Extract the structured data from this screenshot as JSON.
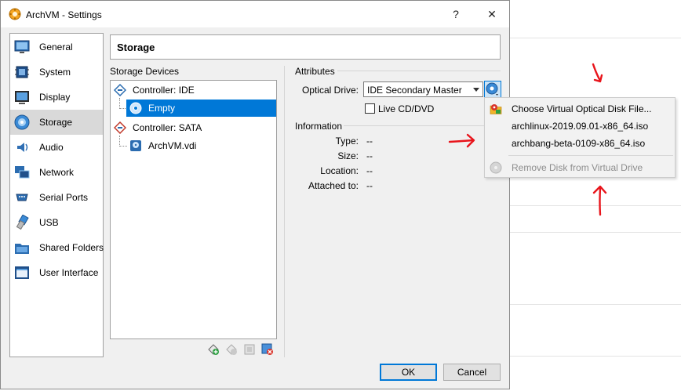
{
  "window": {
    "title": "ArchVM - Settings",
    "help_label": "?",
    "close_label": "✕"
  },
  "sidebar": {
    "items": [
      {
        "label": "General",
        "icon": "general-icon"
      },
      {
        "label": "System",
        "icon": "system-icon"
      },
      {
        "label": "Display",
        "icon": "display-icon"
      },
      {
        "label": "Storage",
        "icon": "storage-icon",
        "selected": true
      },
      {
        "label": "Audio",
        "icon": "audio-icon"
      },
      {
        "label": "Network",
        "icon": "network-icon"
      },
      {
        "label": "Serial Ports",
        "icon": "serial-ports-icon"
      },
      {
        "label": "USB",
        "icon": "usb-icon"
      },
      {
        "label": "Shared Folders",
        "icon": "shared-folders-icon"
      },
      {
        "label": "User Interface",
        "icon": "user-interface-icon"
      }
    ]
  },
  "section": {
    "title": "Storage"
  },
  "storage_devices": {
    "label": "Storage Devices",
    "controller_ide": "Controller: IDE",
    "ide_empty": "Empty",
    "controller_sata": "Controller: SATA",
    "sata_disk": "ArchVM.vdi"
  },
  "attributes": {
    "label": "Attributes",
    "optical_drive_label": "Optical Drive:",
    "optical_drive_value": "IDE Secondary Master",
    "live_cd_label": "Live CD/DVD"
  },
  "information": {
    "label": "Information",
    "rows": [
      {
        "label": "Type:",
        "value": "--"
      },
      {
        "label": "Size:",
        "value": "--"
      },
      {
        "label": "Location:",
        "value": "--"
      },
      {
        "label": "Attached to:",
        "value": "--"
      }
    ]
  },
  "buttons": {
    "ok": "OK",
    "cancel": "Cancel"
  },
  "disk_menu": {
    "items": [
      {
        "label": "Choose Virtual Optical Disk File...",
        "icon": "folder-disk-icon"
      },
      {
        "label": "archlinux-2019.09.01-x86_64.iso"
      },
      {
        "label": "archbang-beta-0109-x86_64.iso"
      },
      {
        "label": "Remove Disk from Virtual Drive",
        "icon": "remove-disk-icon",
        "disabled": true
      }
    ]
  },
  "colors": {
    "selection": "#0078d7",
    "annotation": "#e8141b"
  }
}
